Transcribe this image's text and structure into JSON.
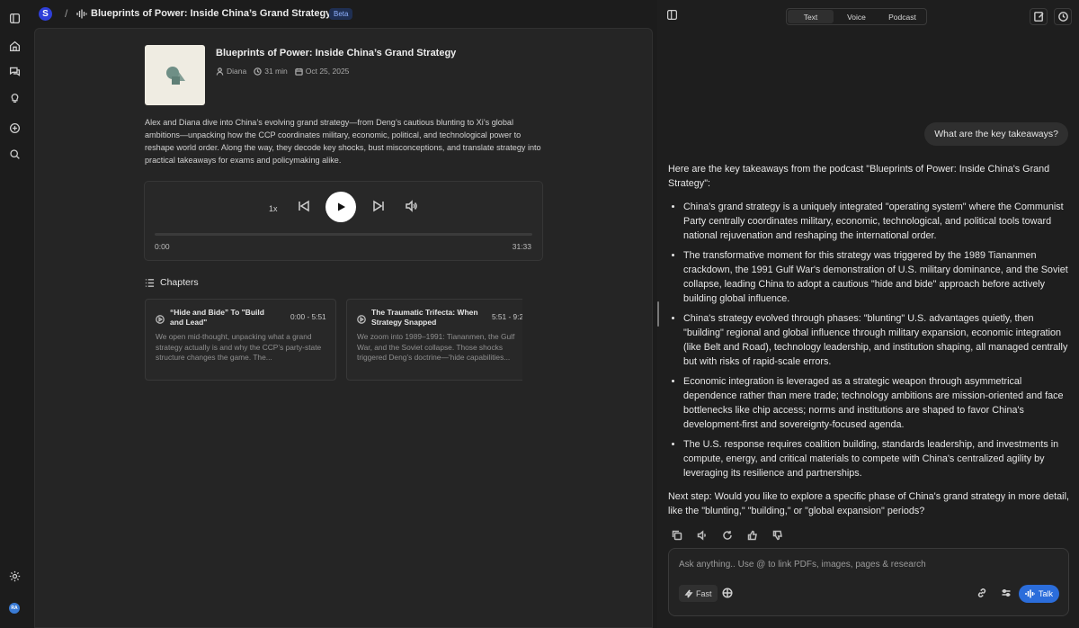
{
  "header": {
    "logo_letter": "S",
    "separator": "/",
    "title": "Blueprints of Power: Inside China’s Grand Strategy",
    "badge": "Beta"
  },
  "sidebar": {
    "items": [
      "sidebar-toggle-icon",
      "home-icon",
      "chat-icon",
      "lightbulb-icon",
      "plus-circle-icon",
      "search-icon"
    ],
    "bottom": [
      "settings-icon"
    ],
    "avatar_initials": "RA"
  },
  "podcast": {
    "title": "Blueprints of Power: Inside China’s Grand Strategy",
    "author": "Diana",
    "duration": "31 min",
    "date": "Oct 25, 2025",
    "description": "Alex and Diana dive into China’s evolving grand strategy—from Deng’s cautious blunting to Xi’s global ambitions—unpacking how the CCP coordinates military, economic, political, and technological power to reshape world order. Along the way, they decode key shocks, bust misconceptions, and translate strategy into practical takeaways for exams and policymaking alike."
  },
  "player": {
    "speed": "1x",
    "current_time": "0:00",
    "total_time": "31:33",
    "progress": 0
  },
  "chapters": {
    "heading": "Chapters",
    "items": [
      {
        "title": "“Hide and Bide” To \"Build and Lead\"",
        "time": "0:00 - 5:51",
        "summary": "We open mid-thought, unpacking what a grand strategy actually is and why the CCP’s party-state structure changes the game. The..."
      },
      {
        "title": "The Traumatic Trifecta: When Strategy Snapped",
        "time": "5:51 - 9:2",
        "summary": "We zoom into 1989–1991: Tiananmen, the Gulf War, and the Soviet collapse. Those shocks triggered Deng’s doctrine—‘hide capabilities..."
      }
    ]
  },
  "right": {
    "modes": [
      "Text",
      "Voice",
      "Podcast"
    ],
    "active_mode": "Text",
    "user_question": "What are the key takeaways?",
    "answer_intro": "Here are the key takeaways from the podcast \"Blueprints of Power: Inside China's Grand Strategy\":",
    "bullets": [
      "China's grand strategy is a uniquely integrated \"operating system\" where the Communist Party centrally coordinates military, economic, technological, and political tools toward national rejuvenation and reshaping the international order.",
      "The transformative moment for this strategy was triggered by the 1989 Tiananmen crackdown, the 1991 Gulf War's demonstration of U.S. military dominance, and the Soviet collapse, leading China to adopt a cautious \"hide and bide\" approach before actively building global influence.",
      "China's strategy evolved through phases: \"blunting\" U.S. advantages quietly, then \"building\" regional and global influence through military expansion, economic integration (like Belt and Road), technology leadership, and institution shaping, all managed centrally but with risks of rapid-scale errors.",
      "Economic integration is leveraged as a strategic weapon through asymmetrical dependence rather than mere trade; technology ambitions are mission-oriented and face bottlenecks like chip access; norms and institutions are shaped to favor China's development-first and sovereignty-focused agenda.",
      "The U.S. response requires coalition building, standards leadership, and investments in compute, energy, and critical materials to compete with China's centralized agility by leveraging its resilience and partnerships."
    ],
    "answer_outro": "Next step: Would you like to explore a specific phase of China's grand strategy in more detail, like the \"blunting,\" \"building,\" or \"global expansion\" periods?",
    "composer": {
      "placeholder": "Ask anything.. Use @ to link PDFs, images, pages & research",
      "fast_label": "Fast",
      "talk_label": "Talk"
    }
  }
}
